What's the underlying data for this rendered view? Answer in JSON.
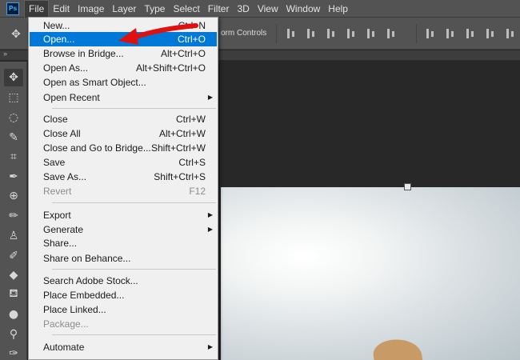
{
  "app": {
    "logo_text": "Ps"
  },
  "menubar": {
    "items": [
      "File",
      "Edit",
      "Image",
      "Layer",
      "Type",
      "Select",
      "Filter",
      "3D",
      "View",
      "Window",
      "Help"
    ]
  },
  "options_bar": {
    "transform_label": "orm Controls"
  },
  "file_menu": {
    "items": [
      {
        "label": "New...",
        "shortcut": "Ctrl+N"
      },
      {
        "label": "Open...",
        "shortcut": "Ctrl+O",
        "highlighted": true
      },
      {
        "label": "Browse in Bridge...",
        "shortcut": "Alt+Ctrl+O"
      },
      {
        "label": "Open As...",
        "shortcut": "Alt+Shift+Ctrl+O"
      },
      {
        "label": "Open as Smart Object..."
      },
      {
        "label": "Open Recent",
        "submenu": true
      },
      {
        "label": "Close",
        "shortcut": "Ctrl+W"
      },
      {
        "label": "Close All",
        "shortcut": "Alt+Ctrl+W"
      },
      {
        "label": "Close and Go to Bridge...",
        "shortcut": "Shift+Ctrl+W"
      },
      {
        "label": "Save",
        "shortcut": "Ctrl+S"
      },
      {
        "label": "Save As...",
        "shortcut": "Shift+Ctrl+S"
      },
      {
        "label": "Revert",
        "shortcut": "F12",
        "disabled": true
      },
      {
        "label": "Export",
        "submenu": true
      },
      {
        "label": "Generate",
        "submenu": true
      },
      {
        "label": "Share..."
      },
      {
        "label": "Share on Behance..."
      },
      {
        "label": "Search Adobe Stock..."
      },
      {
        "label": "Place Embedded..."
      },
      {
        "label": "Place Linked..."
      },
      {
        "label": "Package...",
        "disabled": true
      },
      {
        "label": "Automate",
        "submenu": true
      }
    ],
    "submenu_glyph": "▶"
  },
  "colors": {
    "menu_highlight": "#0078d7",
    "annotation_arrow": "#e01010",
    "menubar_bg": "#535353",
    "menu_bg": "#f0f0f0"
  },
  "icons": {
    "move": "move-icon",
    "marquee": "marquee-icon",
    "lasso": "lasso-icon",
    "quick_select": "quick-select-icon",
    "crop": "crop-icon",
    "eyedropper": "eyedropper-icon",
    "healing": "healing-brush-icon",
    "brush": "brush-icon",
    "stamp": "clone-stamp-icon",
    "history_brush": "history-brush-icon",
    "eraser": "eraser-icon",
    "bucket": "paint-bucket-icon",
    "blur": "blur-icon",
    "dodge": "dodge-icon",
    "pen": "pen-icon"
  }
}
